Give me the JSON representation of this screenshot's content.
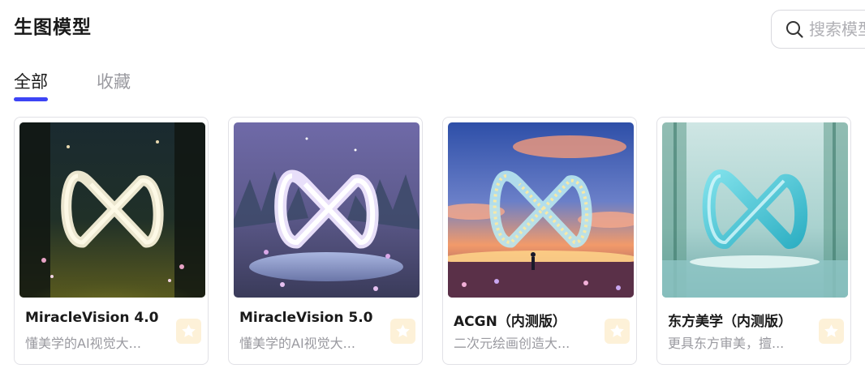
{
  "header": {
    "title": "生图模型",
    "search": {
      "placeholder": "搜索模型",
      "value": ""
    }
  },
  "tabs": [
    {
      "label": "全部",
      "active": true
    },
    {
      "label": "收藏",
      "active": false
    }
  ],
  "accent_color": "#3d44f5",
  "favorite_color": "#fdf1d8",
  "cards": [
    {
      "name": "MiracleVision 4.0",
      "desc": "懂美学的AI视觉大...",
      "image": "glowing infinity logo in dark enchanted forest",
      "icon": "star-icon"
    },
    {
      "name": "MiracleVision 5.0",
      "desc": "懂美学的AI视觉大...",
      "image": "luminous infinity logo in purple night forest by lake",
      "icon": "star-icon"
    },
    {
      "name": "ACGN（内测版）",
      "desc": "二次元绘画创造大...",
      "image": "sparkling infinity logo over anime sunset meadow with girl",
      "icon": "star-icon"
    },
    {
      "name": "东方美学（内测版）",
      "desc": "更具东方审美，擅...",
      "image": "cyan glass infinity logo in misty bamboo pavilion",
      "icon": "star-icon"
    }
  ]
}
